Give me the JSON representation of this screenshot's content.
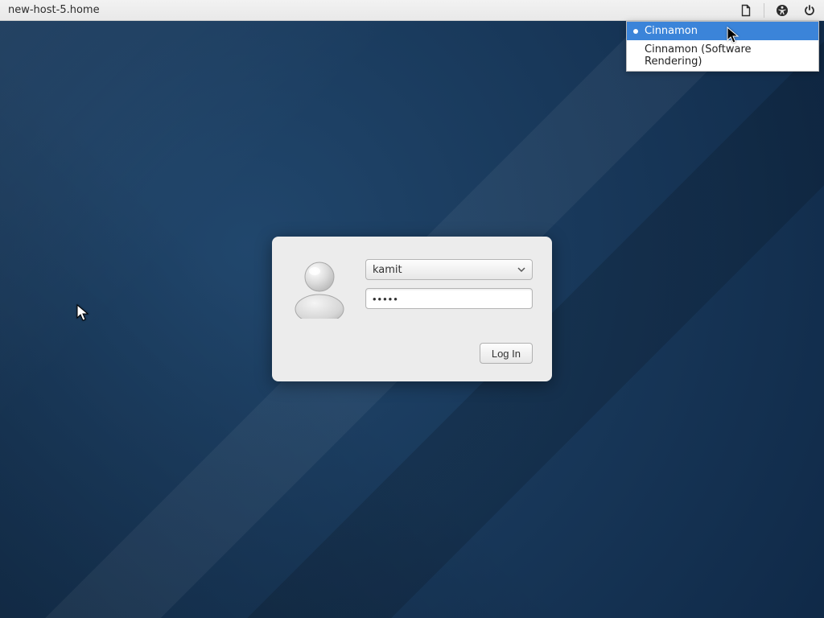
{
  "panel": {
    "hostname": "new-host-5.home"
  },
  "session_menu": {
    "items": [
      {
        "label": "Cinnamon",
        "selected": true
      },
      {
        "label": "Cinnamon (Software Rendering)",
        "selected": false
      }
    ]
  },
  "login": {
    "username": "kamit",
    "password_mask": "•••••",
    "button_label": "Log In"
  }
}
